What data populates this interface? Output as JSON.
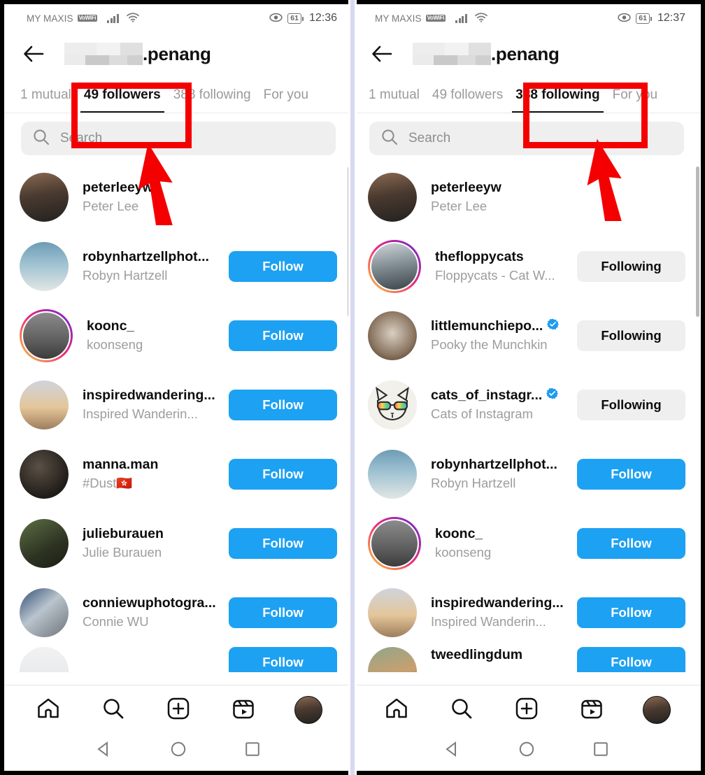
{
  "panels": [
    {
      "id": "left",
      "statusbar": {
        "carrier": "MY MAXIS",
        "network_badge": "VoWiFi",
        "battery": "61",
        "time": "12:36",
        "signal_icon": "signal-bars-icon",
        "wifi_icon": "wifi-icon",
        "eye_icon": "eye-icon"
      },
      "header": {
        "back_icon": "back-arrow-icon",
        "handle_visible": ".penang",
        "handle_blurred": true
      },
      "tabs": [
        {
          "label": "1 mutual",
          "active": false
        },
        {
          "label": "49 followers",
          "active": true
        },
        {
          "label": "388 following",
          "active": false
        },
        {
          "label": "For you",
          "active": false
        }
      ],
      "search": {
        "placeholder": "Search",
        "icon": "search-icon"
      },
      "rows": [
        {
          "username": "peterleeyw",
          "fullname": "Peter Lee",
          "button": null,
          "verified": false,
          "ring": false,
          "avatar": "ph-person"
        },
        {
          "username": "robynhartzellphot...",
          "fullname": "Robyn Hartzell",
          "button": "Follow",
          "button_state": "follow",
          "verified": false,
          "ring": false,
          "avatar": "ph-beach"
        },
        {
          "username": "koonc_",
          "fullname": "koonseng",
          "button": "Follow",
          "button_state": "follow",
          "verified": false,
          "ring": true,
          "avatar": "ph-gray"
        },
        {
          "username": "inspiredwandering...",
          "fullname": "Inspired Wanderin...",
          "button": "Follow",
          "button_state": "follow",
          "verified": false,
          "ring": false,
          "avatar": "ph-desert"
        },
        {
          "username": "manna.man",
          "fullname": "#Dust🇭🇰",
          "button": "Follow",
          "button_state": "follow",
          "verified": false,
          "ring": false,
          "avatar": "ph-dark"
        },
        {
          "username": "julieburauen",
          "fullname": "Julie Burauen",
          "button": "Follow",
          "button_state": "follow",
          "verified": false,
          "ring": false,
          "avatar": "ph-forest"
        },
        {
          "username": "conniewuphotogra...",
          "fullname": "Connie WU",
          "button": "Follow",
          "button_state": "follow",
          "verified": false,
          "ring": false,
          "avatar": "ph-moto"
        },
        {
          "username": "",
          "fullname": "",
          "button": "Follow",
          "button_state": "follow",
          "verified": false,
          "ring": false,
          "avatar": "ph-bridge",
          "partial": true
        }
      ],
      "annotation": {
        "box_target": "49 followers",
        "arrow": "arrow-up-to-followers-tab",
        "color": "#f40000"
      }
    },
    {
      "id": "right",
      "statusbar": {
        "carrier": "MY MAXIS",
        "network_badge": "VoWiFi",
        "battery": "61",
        "time": "12:37",
        "signal_icon": "signal-bars-icon",
        "wifi_icon": "wifi-icon",
        "eye_icon": "eye-icon"
      },
      "header": {
        "back_icon": "back-arrow-icon",
        "handle_visible": ".penang",
        "handle_blurred": true
      },
      "tabs": [
        {
          "label": "1 mutual",
          "active": false
        },
        {
          "label": "49 followers",
          "active": false
        },
        {
          "label": "388 following",
          "active": true
        },
        {
          "label": "For you",
          "active": false
        }
      ],
      "search": {
        "placeholder": "Search",
        "icon": "search-icon"
      },
      "rows": [
        {
          "username": "peterleeyw",
          "fullname": "Peter Lee",
          "button": null,
          "verified": false,
          "ring": false,
          "avatar": "ph-person"
        },
        {
          "username": "thefloppycats",
          "fullname": "Floppycats - Cat W...",
          "button": "Following",
          "button_state": "following",
          "verified": false,
          "ring": true,
          "avatar": "ph-floppy"
        },
        {
          "username": "littlemunchiepo...",
          "fullname": "Pooky the Munchkin",
          "button": "Following",
          "button_state": "following",
          "verified": true,
          "ring": false,
          "avatar": "ph-cat"
        },
        {
          "username": "cats_of_instagr...",
          "fullname": "Cats of Instagram",
          "button": "Following",
          "button_state": "following",
          "verified": true,
          "ring": false,
          "avatar": "ph-white"
        },
        {
          "username": "robynhartzellphot...",
          "fullname": "Robyn Hartzell",
          "button": "Follow",
          "button_state": "follow",
          "verified": false,
          "ring": false,
          "avatar": "ph-beach"
        },
        {
          "username": "koonc_",
          "fullname": "koonseng",
          "button": "Follow",
          "button_state": "follow",
          "verified": false,
          "ring": true,
          "avatar": "ph-gray"
        },
        {
          "username": "inspiredwandering...",
          "fullname": "Inspired Wanderin...",
          "button": "Follow",
          "button_state": "follow",
          "verified": false,
          "ring": false,
          "avatar": "ph-desert"
        },
        {
          "username": "tweedlingdum",
          "fullname": "",
          "button": "Follow",
          "button_state": "follow",
          "verified": false,
          "ring": false,
          "avatar": "ph-dog",
          "partial": true
        }
      ],
      "annotation": {
        "box_target": "388 following",
        "arrow": "arrow-up-to-following-tab",
        "color": "#f40000"
      }
    }
  ],
  "bottom_nav": {
    "items": [
      {
        "icon": "home-icon",
        "label": "Home"
      },
      {
        "icon": "search-icon",
        "label": "Search"
      },
      {
        "icon": "add-post-icon",
        "label": "Create"
      },
      {
        "icon": "reels-icon",
        "label": "Reels"
      },
      {
        "icon": "profile-avatar",
        "label": "Profile"
      }
    ]
  },
  "system_nav": {
    "items": [
      {
        "icon": "back-triangle-icon",
        "label": "Back"
      },
      {
        "icon": "home-circle-icon",
        "label": "Home"
      },
      {
        "icon": "recents-square-icon",
        "label": "Recents"
      }
    ]
  },
  "colors": {
    "follow_blue": "#1da1f2",
    "following_gray": "#efefef",
    "annotation_red": "#f40000",
    "verified_blue": "#1d9bf0",
    "divider_lavender": "#d6d9ef"
  }
}
